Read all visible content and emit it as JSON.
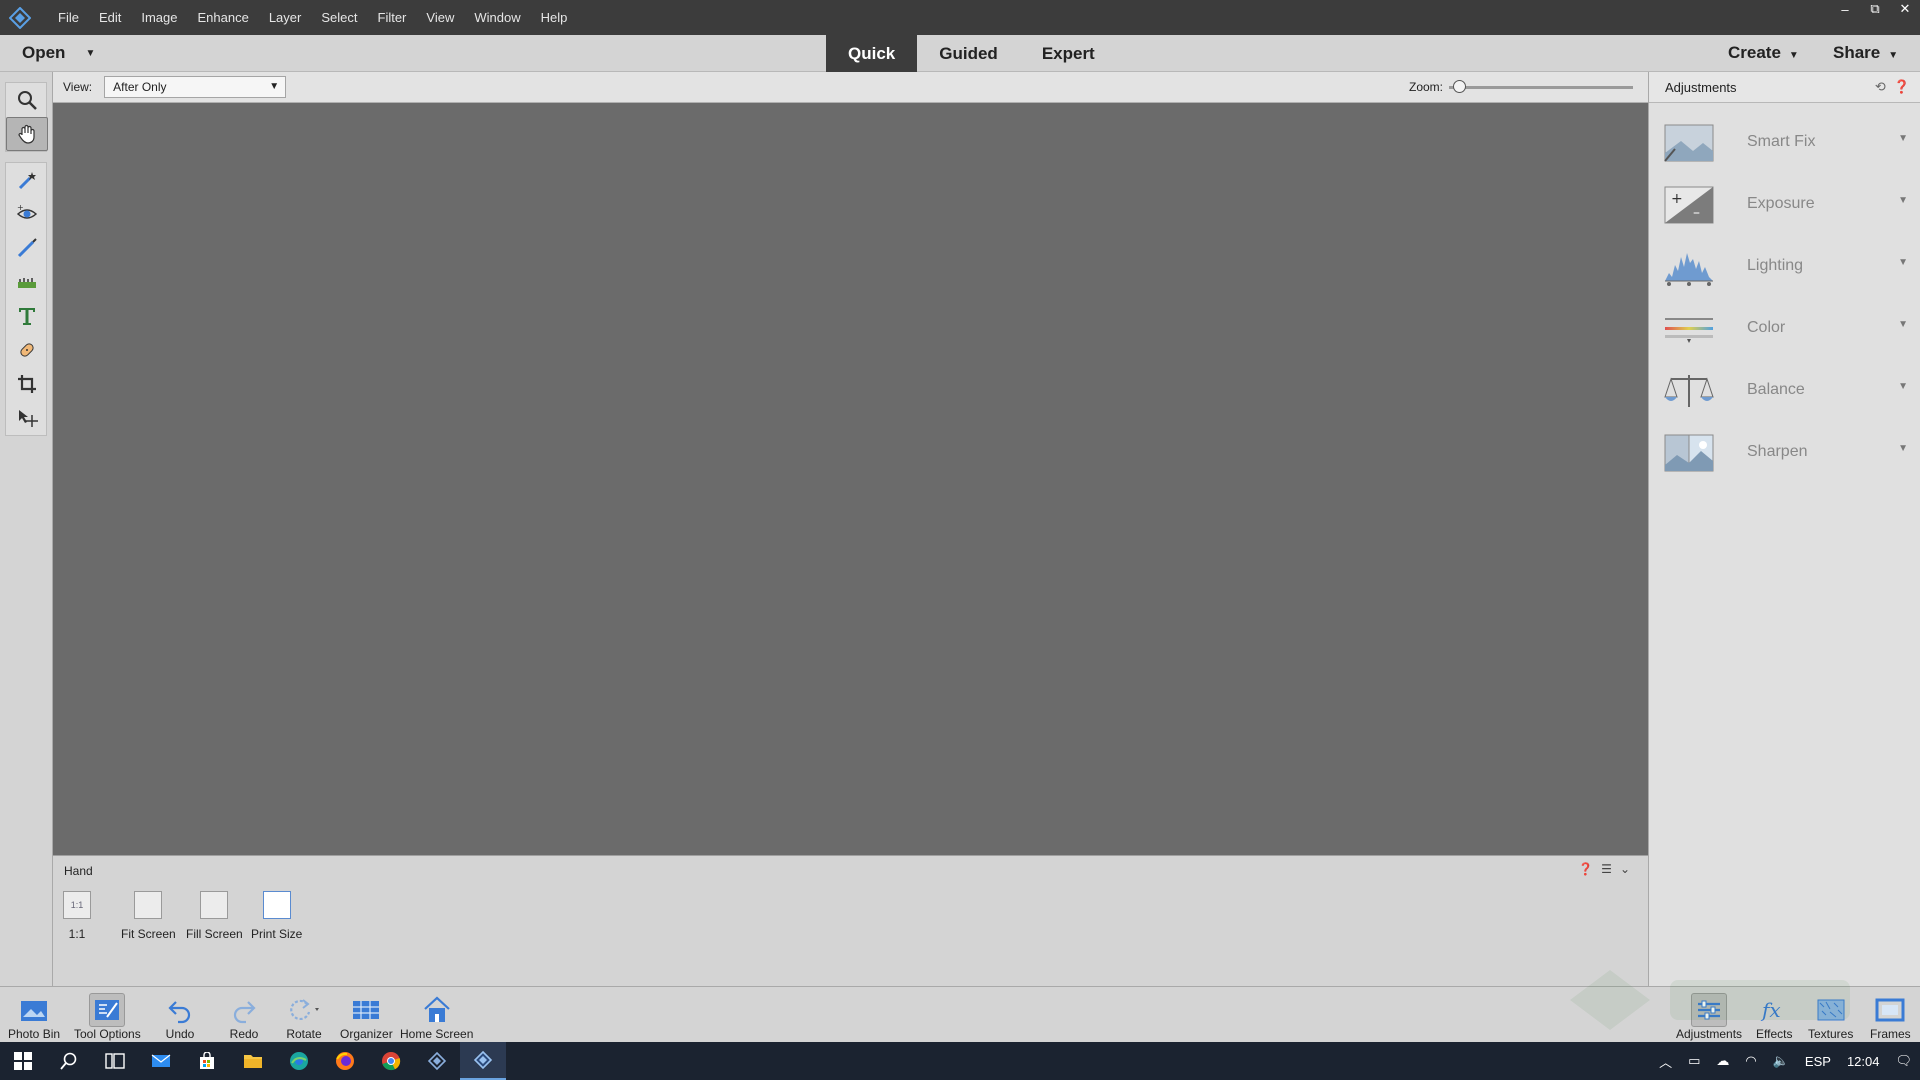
{
  "menubar": {
    "items": [
      "File",
      "Edit",
      "Image",
      "Enhance",
      "Layer",
      "Select",
      "Filter",
      "View",
      "Window",
      "Help"
    ],
    "window_controls": [
      "‒",
      "⧉",
      "✕"
    ]
  },
  "modebar": {
    "open_label": "Open",
    "tabs": [
      {
        "label": "Quick",
        "active": true
      },
      {
        "label": "Guided",
        "active": false
      },
      {
        "label": "Expert",
        "active": false
      }
    ],
    "create_label": "Create",
    "share_label": "Share"
  },
  "viewbar": {
    "view_label": "View:",
    "view_value": "After Only",
    "zoom_label": "Zoom:",
    "zoom_value": "1%",
    "zoom_level": 0.01
  },
  "tools": [
    "zoom-tool",
    "hand-tool",
    "quick-selection-tool",
    "red-eye-tool",
    "whiten-teeth-tool",
    "straighten-tool",
    "type-tool",
    "spot-healing-tool",
    "crop-tool",
    "move-tool"
  ],
  "tool_options": {
    "title": "Hand",
    "buttons": [
      {
        "label": "1:1",
        "icon_text": "1:1"
      },
      {
        "label": "Fit Screen",
        "icon_text": ""
      },
      {
        "label": "Fill Screen",
        "icon_text": ""
      },
      {
        "label": "Print Size",
        "icon_text": ""
      }
    ]
  },
  "adjustments": {
    "title": "Adjustments",
    "items": [
      "Smart Fix",
      "Exposure",
      "Lighting",
      "Color",
      "Balance",
      "Sharpen"
    ]
  },
  "bottombar": {
    "left": [
      "Photo Bin",
      "Tool Options",
      "Undo",
      "Redo",
      "Rotate",
      "Organizer",
      "Home Screen"
    ],
    "right": [
      "Adjustments",
      "Effects",
      "Textures",
      "Frames"
    ]
  },
  "taskbar": {
    "lang": "ESP",
    "time": "12:04"
  },
  "colors": {
    "accent_blue": "#3a7bd5",
    "canvas": "#6b6b6b",
    "dark_bar": "#3c3c3c"
  }
}
